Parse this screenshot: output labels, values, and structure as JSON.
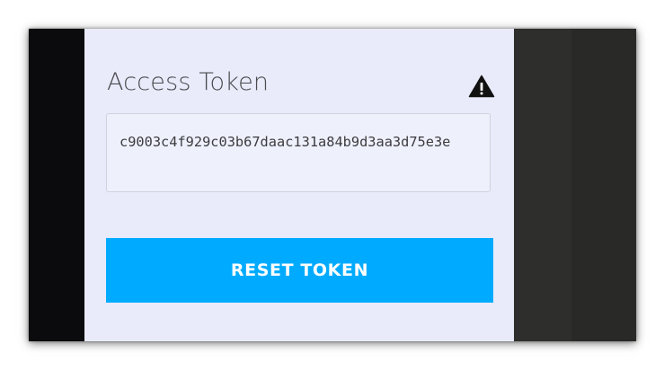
{
  "panel": {
    "title": "Access Token",
    "warning_icon": "warning-triangle-icon",
    "token_value": "c9003c4f929c03b67daac131a84b9d3aa3d75e3e",
    "reset_button_label": "RESET TOKEN"
  },
  "colors": {
    "panel_bg": "#e9ebfa",
    "button_bg": "#00abff",
    "button_text": "#ffffff",
    "dark_bg": "#0b0b0d"
  }
}
